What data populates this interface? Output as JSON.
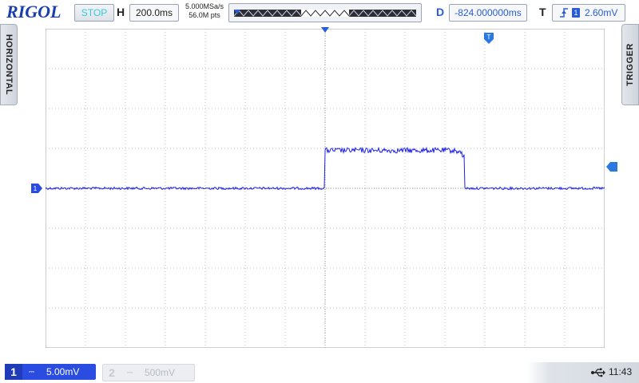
{
  "brand": "RIGOL",
  "run_state": "STOP",
  "horizontal": {
    "label": "H",
    "timebase": "200.0ms",
    "sample_rate": "5.000MSa/s",
    "memory_depth": "56.0M pts"
  },
  "delay": {
    "label": "D",
    "value": "-824.000000ms"
  },
  "trigger": {
    "label": "T",
    "source": "1",
    "level": "2.60mV",
    "edge_icon": "rising-edge-icon"
  },
  "side_tabs": {
    "left": "HORIZONTAL",
    "right": "TRIGGER"
  },
  "channels": [
    {
      "number": "1",
      "coupling": "DC",
      "scale": "5.00mV",
      "active": true,
      "color": "#2a4ce0"
    },
    {
      "number": "2",
      "coupling": "DC",
      "scale": "500mV",
      "active": false,
      "color": "#c6c9d0"
    }
  ],
  "markers": {
    "ch1_ground": "1",
    "trigger_position": "T"
  },
  "status": {
    "usb_icon": "usb-icon",
    "time": "11:43"
  },
  "waveform": {
    "color": "#1f22e6",
    "baseline_divisions": 0.0,
    "pulse_start_fraction": 0.5,
    "pulse_end_fraction": 0.75,
    "pulse_height_divisions": 0.95,
    "noise_divisions": 0.06
  },
  "grid": {
    "h_divisions": 14,
    "v_divisions": 8,
    "background": "#ffffff",
    "line_color": "#bfbfbf"
  }
}
